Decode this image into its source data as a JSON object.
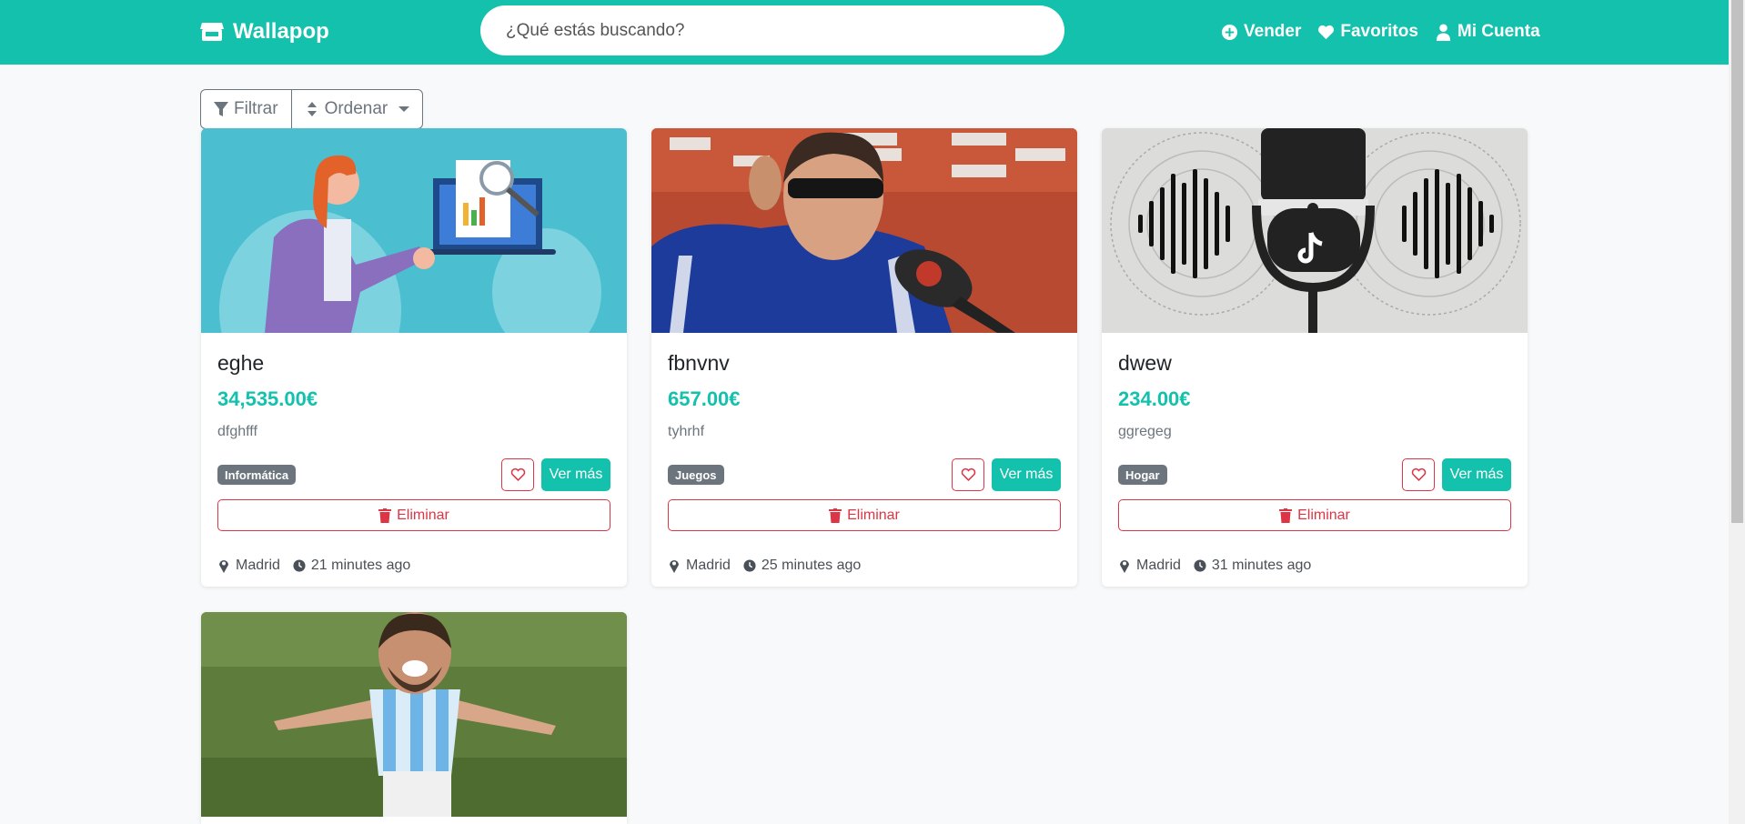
{
  "nav": {
    "brand": "Wallapop",
    "search_placeholder": "¿Qué estás buscando?",
    "links": [
      {
        "label": "Vender",
        "icon": "plus-circle-icon"
      },
      {
        "label": "Favoritos",
        "icon": "heart-icon"
      },
      {
        "label": "Mi Cuenta",
        "icon": "user-icon"
      }
    ]
  },
  "toolbar": {
    "filter_label": "Filtrar",
    "sort_label": "Ordenar"
  },
  "colors": {
    "brand": "#13c1ac",
    "danger": "#dc3545",
    "badge": "#6c757d"
  },
  "products": [
    {
      "title": "eghe",
      "price": "34,535.00€",
      "description": "dfghfff",
      "category": "Informática",
      "more_label": "Ver más",
      "delete_label": "Eliminar",
      "location": "Madrid",
      "time": "21 minutes ago",
      "image": "woman-presenting-laptop-illustration"
    },
    {
      "title": "fbnvnv",
      "price": "657.00€",
      "description": "tyhrhf",
      "category": "Juegos",
      "more_label": "Ver más",
      "delete_label": "Eliminar",
      "location": "Madrid",
      "time": "25 minutes ago",
      "image": "man-with-sunglasses-press-conference"
    },
    {
      "title": "dwew",
      "price": "234.00€",
      "description": "ggregeg",
      "category": "Hogar",
      "more_label": "Ver más",
      "delete_label": "Eliminar",
      "location": "Madrid",
      "time": "31 minutes ago",
      "image": "microphone-soundwave-tiktok"
    },
    {
      "image": "football-player-celebrating"
    }
  ]
}
